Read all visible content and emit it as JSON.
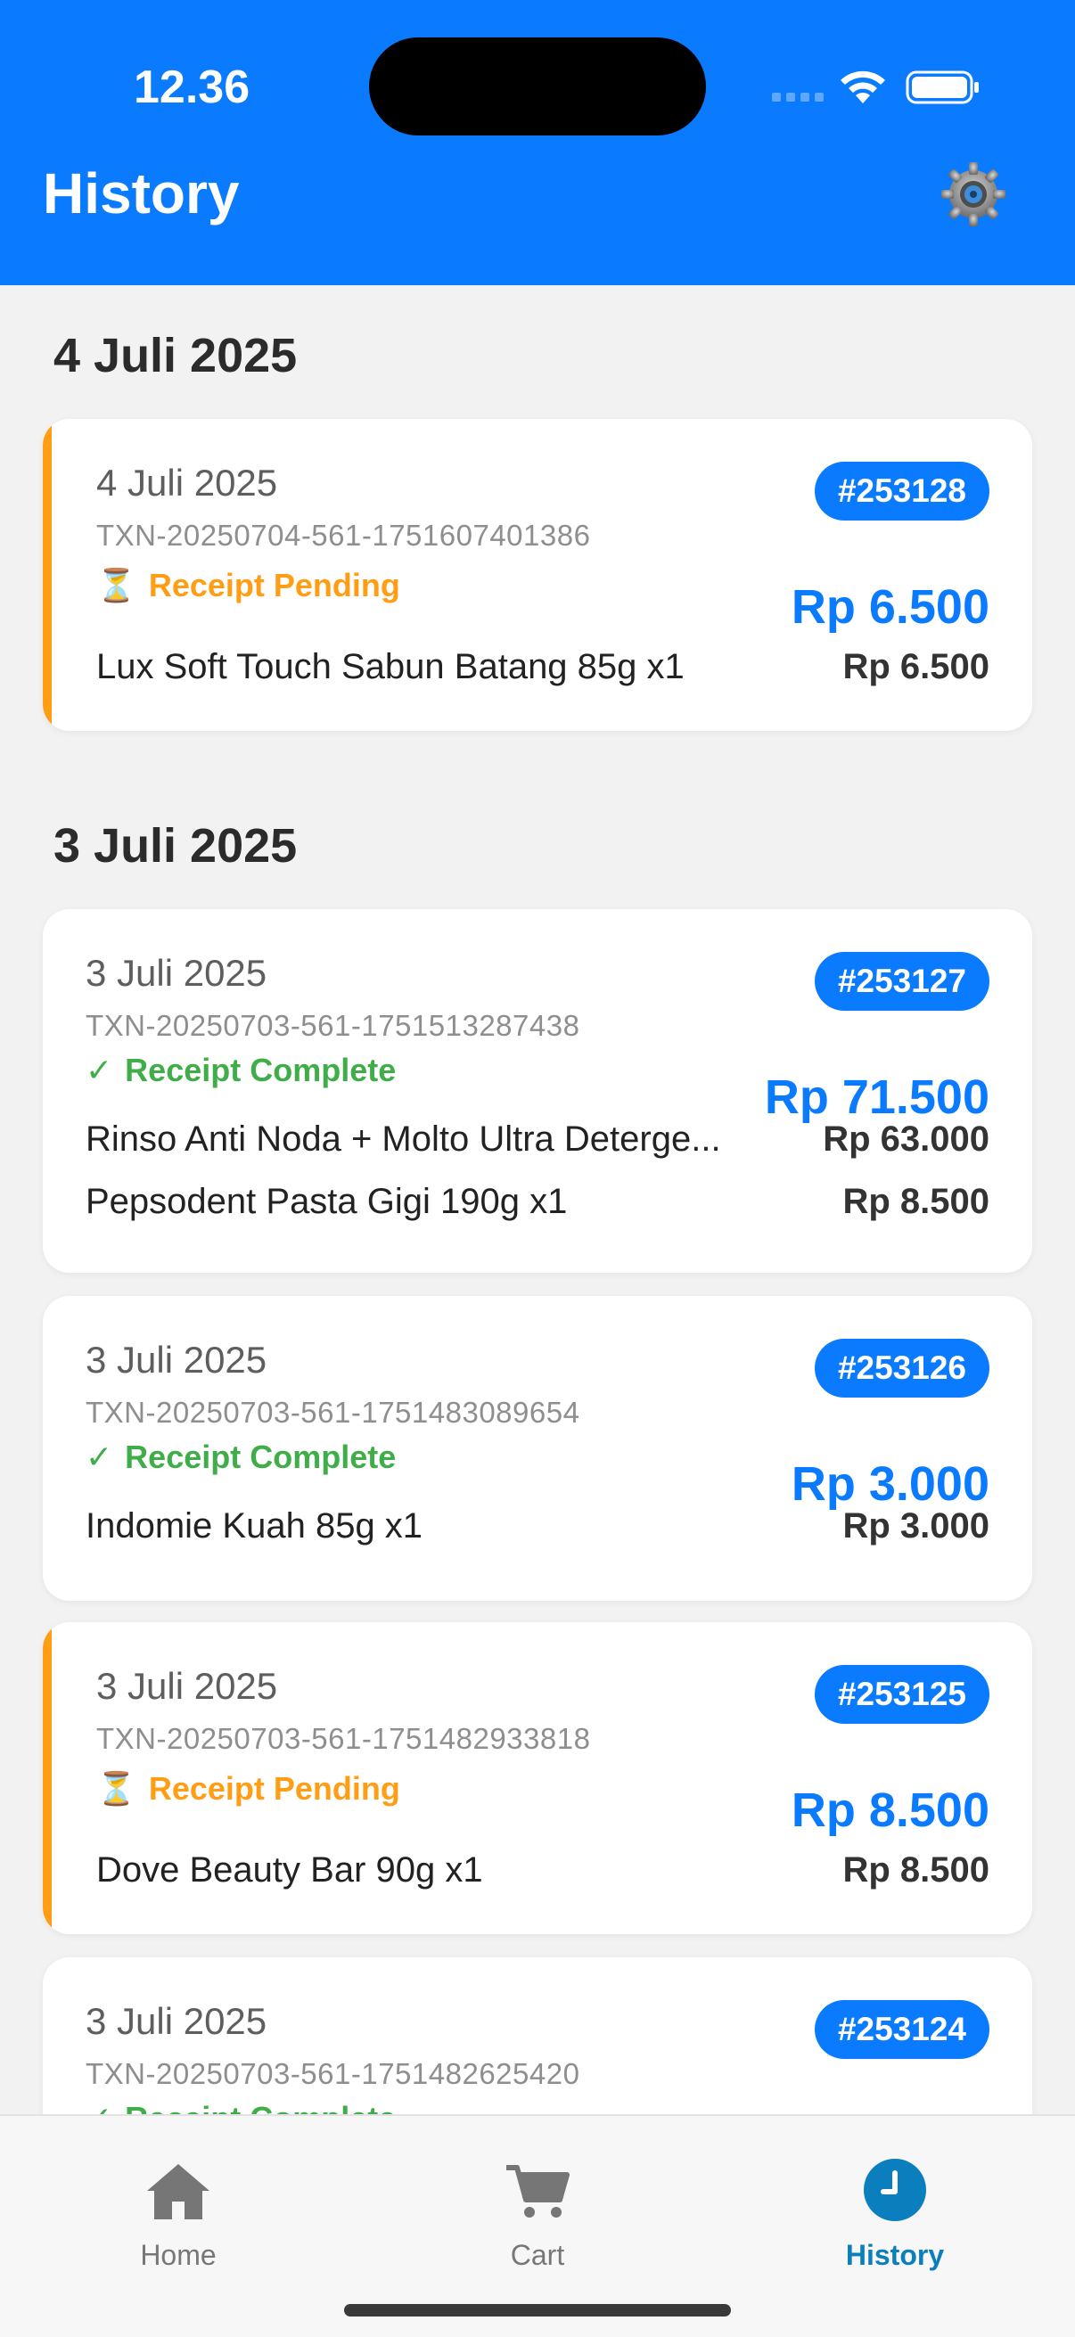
{
  "status_bar": {
    "time": "12.36"
  },
  "header": {
    "title": "History",
    "settings_icon": "gear-icon"
  },
  "colors": {
    "accent": "#0a7aff",
    "pending": "#ff9d14",
    "complete": "#3fae49",
    "tab_active": "#0b7ebd"
  },
  "groups": [
    {
      "heading": "4 Juli 2025",
      "cards": [
        {
          "date": "4 Juli 2025",
          "txn": "TXN-20250704-561-1751607401386",
          "status": "Receipt Pending",
          "status_type": "pending",
          "badge": "#253128",
          "total": "Rp 6.500",
          "items": [
            {
              "name": "Lux Soft Touch Sabun Batang 85g x1",
              "price": "Rp 6.500"
            }
          ]
        }
      ]
    },
    {
      "heading": "3 Juli 2025",
      "cards": [
        {
          "date": "3 Juli 2025",
          "txn": "TXN-20250703-561-1751513287438",
          "status": "Receipt Complete",
          "status_type": "complete",
          "badge": "#253127",
          "total": "Rp 71.500",
          "items": [
            {
              "name": "Rinso Anti Noda + Molto Ultra Deterge...",
              "price": "Rp 63.000"
            },
            {
              "name": "Pepsodent Pasta Gigi 190g x1",
              "price": "Rp 8.500"
            }
          ]
        },
        {
          "date": "3 Juli 2025",
          "txn": "TXN-20250703-561-1751483089654",
          "status": "Receipt Complete",
          "status_type": "complete",
          "badge": "#253126",
          "total": "Rp 3.000",
          "items": [
            {
              "name": "Indomie Kuah 85g x1",
              "price": "Rp 3.000"
            }
          ]
        },
        {
          "date": "3 Juli 2025",
          "txn": "TXN-20250703-561-1751482933818",
          "status": "Receipt Pending",
          "status_type": "pending",
          "badge": "#253125",
          "total": "Rp 8.500",
          "items": [
            {
              "name": "Dove Beauty Bar 90g x1",
              "price": "Rp 8.500"
            }
          ]
        },
        {
          "date": "3 Juli 2025",
          "txn": "TXN-20250703-561-1751482625420",
          "status": "Receipt Complete",
          "status_type": "complete",
          "badge": "#253124"
        }
      ]
    }
  ],
  "tabbar": {
    "tabs": [
      {
        "label": "Home",
        "icon": "home-icon",
        "active": false
      },
      {
        "label": "Cart",
        "icon": "cart-icon",
        "active": false
      },
      {
        "label": "History",
        "icon": "clock-icon",
        "active": true
      }
    ]
  }
}
